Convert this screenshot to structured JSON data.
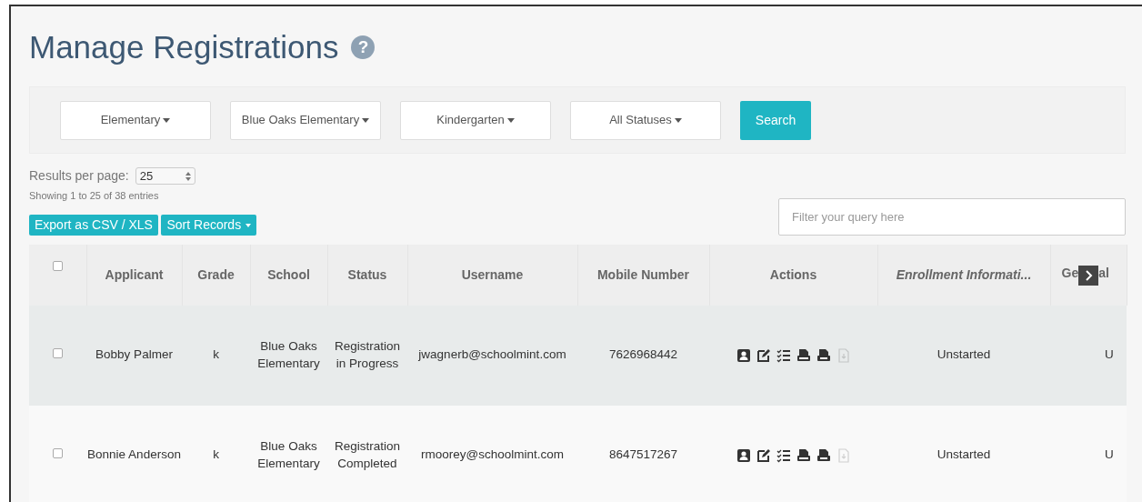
{
  "title": "Manage Registrations",
  "help": "?",
  "filters": [
    {
      "label": "Elementary"
    },
    {
      "label": "Blue Oaks Elementary"
    },
    {
      "label": "Kindergarten"
    },
    {
      "label": "All Statuses"
    }
  ],
  "search_button": "Search",
  "results_per_page": {
    "label": "Results per page:",
    "value": "25"
  },
  "showing": "Showing 1 to 25 of 38 entries",
  "toolbar": [
    {
      "label": "Export as CSV / XLS",
      "kind": "button"
    },
    {
      "label": "Sort Records",
      "kind": "dropdown"
    }
  ],
  "query": {
    "placeholder": "Filter your query here"
  },
  "table": {
    "select_all": {
      "checked": false
    },
    "columns": [
      {
        "label": "Applicant",
        "italic": false
      },
      {
        "label": "Grade",
        "italic": false
      },
      {
        "label": "School",
        "italic": false
      },
      {
        "label": "Status",
        "italic": false
      },
      {
        "label": "Username",
        "italic": false
      },
      {
        "label": "Mobile Number",
        "italic": false
      },
      {
        "label": "Actions",
        "italic": false
      },
      {
        "label": "Enrollment Informati...",
        "italic": true
      },
      {
        "label": "Ge",
        "label_after": "al",
        "italic": false
      }
    ],
    "rows": [
      {
        "checked": false,
        "selected": true,
        "cells": [
          "Bobby Palmer",
          "k",
          "Blue Oaks Elementary",
          "Registration in Progress",
          "jwagnerb@schoolmint.com",
          "7626968442",
          null,
          "Unstarted",
          "U"
        ],
        "actions": [
          {
            "kind": "contact",
            "disabled": false
          },
          {
            "kind": "edit",
            "disabled": false
          },
          {
            "kind": "checklist",
            "disabled": false
          },
          {
            "kind": "pdf",
            "disabled": false
          },
          {
            "kind": "zip",
            "disabled": false
          },
          {
            "kind": "download",
            "disabled": true
          }
        ]
      },
      {
        "checked": false,
        "selected": false,
        "cells": [
          "Bonnie Anderson",
          "k",
          "Blue Oaks Elementary",
          "Registration Completed",
          "rmoorey@schoolmint.com",
          "8647517267",
          null,
          "Unstarted",
          "U"
        ],
        "actions": [
          {
            "kind": "contact",
            "disabled": false
          },
          {
            "kind": "edit",
            "disabled": false
          },
          {
            "kind": "checklist",
            "disabled": false
          },
          {
            "kind": "pdf",
            "disabled": false
          },
          {
            "kind": "zip",
            "disabled": false
          },
          {
            "kind": "download",
            "disabled": true
          }
        ]
      }
    ]
  }
}
